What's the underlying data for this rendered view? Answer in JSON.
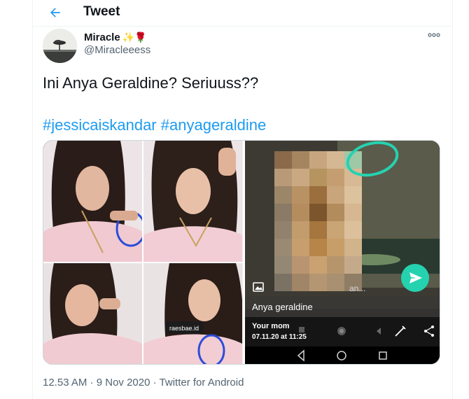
{
  "header": {
    "title": "Tweet"
  },
  "author": {
    "display_name": "Miracle",
    "emojis": "✨🌹",
    "handle": "@Miracleeess"
  },
  "tweet": {
    "text": "Ini Anya Geraldine? Seriuuss??",
    "hashtags": [
      "#jessicaiskandar",
      "#anyageraldine"
    ]
  },
  "media": {
    "watermark": "raesbae.id",
    "caption_name": "Anya geraldine",
    "caption_partial": "an...",
    "sender": "Your mom",
    "timestamp": "07.11.20 at 11:25"
  },
  "meta": {
    "time": "12.53 AM",
    "date": "9 Nov 2020",
    "separator": "·",
    "source": "Twitter for Android"
  },
  "colors": {
    "accent": "#1d9bf0",
    "text": "#0f1419",
    "secondary": "#536471",
    "whatsapp_green": "#25d2b0"
  }
}
